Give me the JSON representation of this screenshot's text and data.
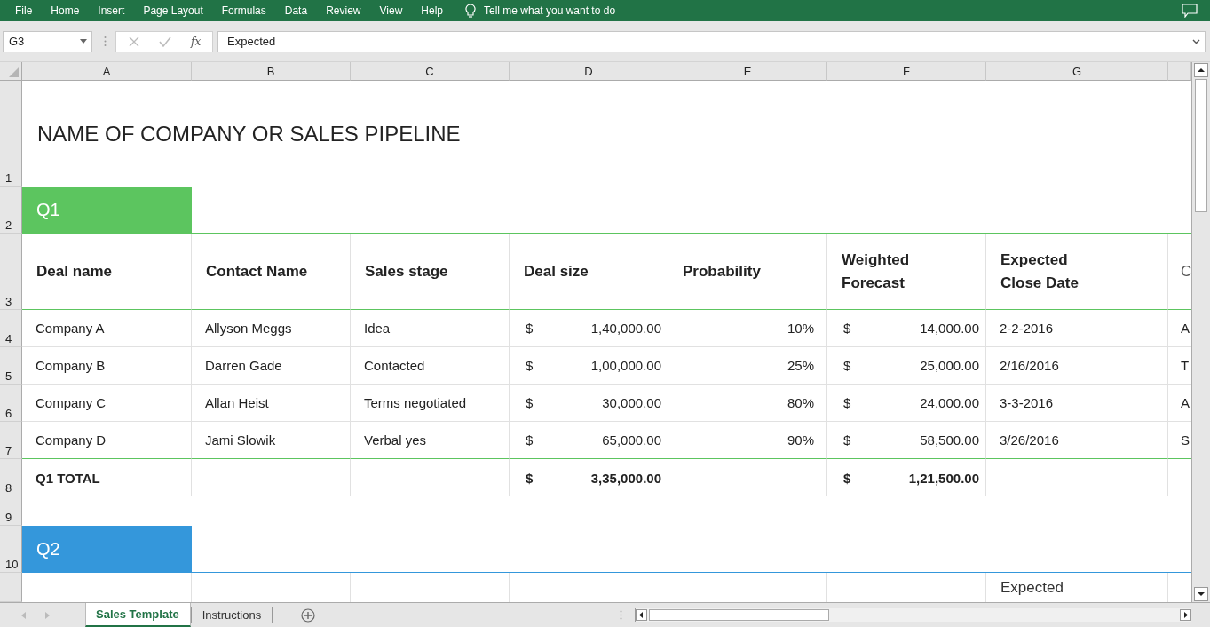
{
  "ribbon": {
    "tabs": [
      "File",
      "Home",
      "Insert",
      "Page Layout",
      "Formulas",
      "Data",
      "Review",
      "View",
      "Help"
    ],
    "tell_me": "Tell me what you want to do"
  },
  "formula_bar": {
    "name_box": "G3",
    "function_label": "fx",
    "formula": "Expected"
  },
  "column_headers": [
    "A",
    "B",
    "C",
    "D",
    "E",
    "F",
    "G"
  ],
  "row_headers": [
    "1",
    "2",
    "3",
    "4",
    "5",
    "6",
    "7",
    "8",
    "9",
    "10"
  ],
  "title": "NAME OF COMPANY OR SALES PIPELINE",
  "sections": [
    {
      "label": "Q1",
      "color": "#5cc55f",
      "columns": [
        "Deal name",
        "Contact Name",
        "Sales stage",
        "Deal size",
        "Probability",
        "Weighted\nForecast",
        "Expected\nClose Date",
        "C"
      ],
      "rows": [
        {
          "deal_name": "Company A",
          "contact_name": "Allyson Meggs",
          "sales_stage": "Idea",
          "deal_size": {
            "currency": "$",
            "amount": "1,40,000.00"
          },
          "probability": "10%",
          "weighted_forecast": {
            "currency": "$",
            "amount": "14,000.00"
          },
          "close_date": "2-2-2016",
          "column_8": "A"
        },
        {
          "deal_name": "Company B",
          "contact_name": "Darren Gade",
          "sales_stage": "Contacted",
          "deal_size": {
            "currency": "$",
            "amount": "1,00,000.00"
          },
          "probability": "25%",
          "weighted_forecast": {
            "currency": "$",
            "amount": "25,000.00"
          },
          "close_date": "2/16/2016",
          "column_8": "T"
        },
        {
          "deal_name": "Company C",
          "contact_name": "Allan Heist",
          "sales_stage": "Terms negotiated",
          "deal_size": {
            "currency": "$",
            "amount": "30,000.00"
          },
          "probability": "80%",
          "weighted_forecast": {
            "currency": "$",
            "amount": "24,000.00"
          },
          "close_date": "3-3-2016",
          "column_8": "A"
        },
        {
          "deal_name": "Company D",
          "contact_name": "Jami Slowik",
          "sales_stage": "Verbal yes",
          "deal_size": {
            "currency": "$",
            "amount": "65,000.00"
          },
          "probability": "90%",
          "weighted_forecast": {
            "currency": "$",
            "amount": "58,500.00"
          },
          "close_date": "3/26/2016",
          "column_8": "S"
        }
      ],
      "total": {
        "label": "Q1 TOTAL",
        "deal_size": {
          "currency": "$",
          "amount": "3,35,000.00"
        },
        "weighted_forecast": {
          "currency": "$",
          "amount": "1,21,500.00"
        }
      }
    },
    {
      "label": "Q2",
      "color": "#3497db",
      "partial_header": "Expected"
    }
  ],
  "sheet_tabs": [
    {
      "label": "Sales Template",
      "selected": true
    },
    {
      "label": "Instructions",
      "selected": false
    }
  ]
}
